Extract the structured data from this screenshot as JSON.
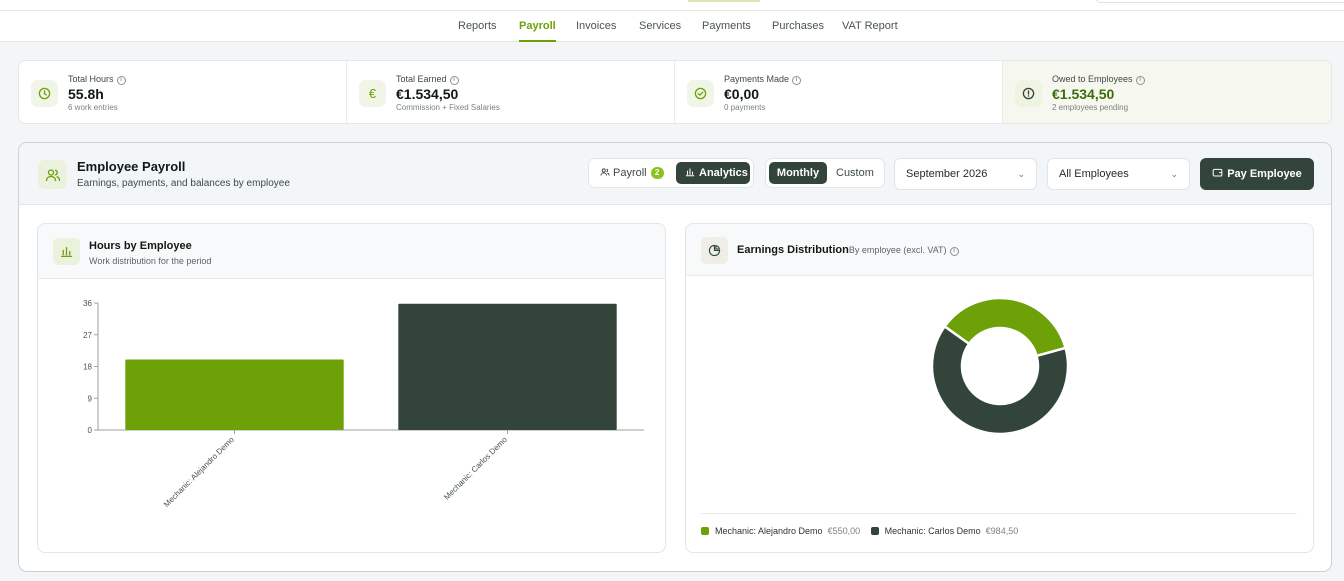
{
  "nav": {
    "tabs": [
      {
        "label": "Reports"
      },
      {
        "label": "Payroll"
      },
      {
        "label": "Invoices"
      },
      {
        "label": "Services"
      },
      {
        "label": "Payments"
      },
      {
        "label": "Purchases"
      },
      {
        "label": "VAT Report"
      }
    ],
    "active": "Payroll"
  },
  "stats": [
    {
      "label": "Total Hours",
      "value": "55.8h",
      "sub": "6 work entries",
      "icon": "clock-icon"
    },
    {
      "label": "Total Earned",
      "value": "€1.534,50",
      "sub": "Commission + Fixed Salaries",
      "icon": "euro-icon"
    },
    {
      "label": "Payments Made",
      "value": "€0,00",
      "sub": "0 payments",
      "icon": "check-circle-icon"
    },
    {
      "label": "Owed to Employees",
      "value": "€1.534,50",
      "sub": "2 employees pending",
      "icon": "alert-circle-icon"
    }
  ],
  "panel": {
    "title": "Employee Payroll",
    "subtitle": "Earnings, payments, and balances by employee",
    "view_toggle": {
      "payroll_label": "Payroll",
      "payroll_badge": "2",
      "analytics_label": "Analytics",
      "active": "Analytics"
    },
    "period_toggle": {
      "monthly_label": "Monthly",
      "custom_label": "Custom",
      "active": "Monthly"
    },
    "month_select": {
      "value": "September 2026"
    },
    "employee_select": {
      "value": "All Employees"
    },
    "pay_button_label": "Pay Employee"
  },
  "hours_card": {
    "title": "Hours by Employee",
    "subtitle": "Work distribution for the period"
  },
  "earnings_card": {
    "title": "Earnings Distribution",
    "subtitle": "By employee (excl. VAT)"
  },
  "colors": {
    "accent": "#6ea107",
    "dark": "#33453a"
  },
  "chart_data": [
    {
      "type": "bar",
      "title": "Hours by Employee",
      "categories": [
        "Mechanic: Alejandro Demo",
        "Mechanic: Carlos Demo"
      ],
      "values": [
        20,
        35.8
      ],
      "ylim": [
        0,
        36
      ],
      "yticks": [
        0,
        9,
        18,
        27,
        36
      ],
      "bar_colors": [
        "#6ea107",
        "#33453a"
      ],
      "grid": false
    },
    {
      "type": "pie",
      "title": "Earnings Distribution",
      "labels": [
        "Mechanic: Alejandro Demo",
        "Mechanic: Carlos Demo"
      ],
      "values": [
        550,
        984.5
      ],
      "display_values": [
        "€550,00",
        "€984,50"
      ],
      "colors": [
        "#6ea107",
        "#33453a"
      ],
      "legend": "bottom"
    }
  ]
}
